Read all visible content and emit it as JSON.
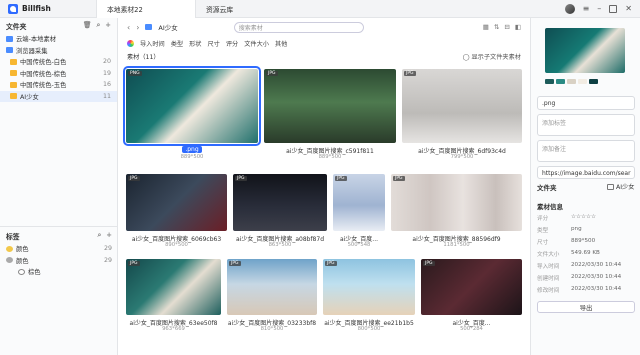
{
  "app": {
    "name": "Billfish"
  },
  "tabs": [
    {
      "label": "本地素材22"
    },
    {
      "label": "资源云库"
    }
  ],
  "sidebar": {
    "folders_title": "文件夹",
    "items": [
      {
        "label": "云端-本地素材",
        "count": ""
      },
      {
        "label": "浏览器采集",
        "count": ""
      },
      {
        "label": "中国传统色-白色",
        "count": "20"
      },
      {
        "label": "中国传统色-棕色",
        "count": "19"
      },
      {
        "label": "中国传统色-玉色",
        "count": "16"
      },
      {
        "label": "AI少女",
        "count": "11"
      }
    ],
    "tags_title": "标签",
    "tags": [
      {
        "label": "颜色",
        "count": "29"
      },
      {
        "label": "颜色",
        "count": "29"
      },
      {
        "label": "棕色",
        "count": ""
      }
    ]
  },
  "main": {
    "breadcrumb": "AI少女",
    "search_placeholder": "搜索素材",
    "filters": [
      "导入时间",
      "类型",
      "形状",
      "尺寸",
      "评分",
      "文件大小",
      "其他"
    ],
    "count_label": "素材（11）",
    "show_sub_label": "显示子文件夹素材",
    "cards": [
      {
        "badge": "PNG",
        "name": ".png",
        "dims": "889*500"
      },
      {
        "badge": "JPG",
        "name": "ai少女_百度图片搜索_c591f811",
        "dims": "889*500"
      },
      {
        "badge": "JPG",
        "name": "ai少女_百度图片搜索_6df93c4d",
        "dims": "799*500"
      },
      {
        "badge": "JPG",
        "name": "ai少女_百度图片搜索_6069cb63",
        "dims": "890*500"
      },
      {
        "badge": "JPG",
        "name": "ai少女_百度图片搜索_a08bf87d",
        "dims": "863*500"
      },
      {
        "badge": "JPG",
        "name": "ai少女_百度...",
        "dims": "500*548"
      },
      {
        "badge": "JPG",
        "name": "ai少女_百度图片搜索_88596df9",
        "dims": "1181*500"
      },
      {
        "badge": "JPG",
        "name": "ai少女_百度图片搜索_63ee50f8",
        "dims": "963*669"
      },
      {
        "badge": "JPG",
        "name": "ai少女_百度图片搜索_03233bf8",
        "dims": "810*500"
      },
      {
        "badge": "JPG",
        "name": "ai少女_百度图片搜索_ee21b1b5",
        "dims": "800*500"
      },
      {
        "badge": "JPG",
        "name": "ai少女_百度...",
        "dims": "500*284"
      }
    ]
  },
  "panel": {
    "ext_value": ".png",
    "tags_placeholder": "添加标签",
    "note_placeholder": "添加备注",
    "url_value": "https://image.baidu.com/sear",
    "folder_label": "文件夹",
    "folder_value": "AI少女",
    "info_title": "素材信息",
    "info": [
      {
        "k": "评分",
        "v": "☆☆☆☆☆"
      },
      {
        "k": "类型",
        "v": "png"
      },
      {
        "k": "尺寸",
        "v": "889*500"
      },
      {
        "k": "文件大小",
        "v": "549.69 KB"
      },
      {
        "k": "导入时间",
        "v": "2022/03/30 10:44"
      },
      {
        "k": "创建时间",
        "v": "2022/03/30 10:44"
      },
      {
        "k": "修改时间",
        "v": "2022/03/30 10:44"
      }
    ],
    "export_label": "导出",
    "swatches": [
      "#1d5b5a",
      "#2a8a84",
      "#d9d1c4",
      "#f2ece3",
      "#0d3f43"
    ]
  }
}
